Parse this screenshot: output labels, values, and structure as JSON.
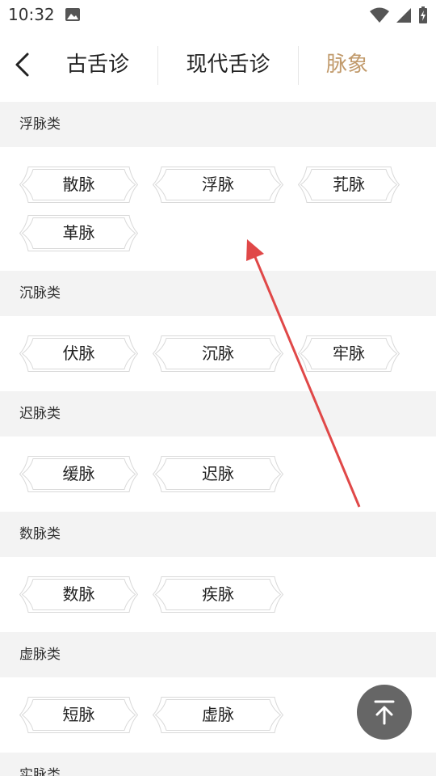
{
  "status_bar": {
    "time": "10:32"
  },
  "nav": {
    "tabs": [
      {
        "label": "古舌诊",
        "active": false
      },
      {
        "label": "现代舌诊",
        "active": false
      },
      {
        "label": "脉象",
        "active": true
      }
    ]
  },
  "categories": [
    {
      "title": "浮脉类",
      "items": [
        "散脉",
        "浮脉",
        "芤脉",
        "革脉"
      ]
    },
    {
      "title": "沉脉类",
      "items": [
        "伏脉",
        "沉脉",
        "牢脉"
      ]
    },
    {
      "title": "迟脉类",
      "items": [
        "缓脉",
        "迟脉"
      ]
    },
    {
      "title": "数脉类",
      "items": [
        "数脉",
        "疾脉"
      ]
    },
    {
      "title": "虚脉类",
      "items": [
        "短脉",
        "虚脉"
      ]
    },
    {
      "title": "实脉类",
      "items": []
    }
  ],
  "colors": {
    "accent": "#c19a6b",
    "section_bg": "#f3f3f3",
    "annotation_arrow": "#e04848",
    "back_top_bg": "#666666"
  },
  "icons": {
    "back": "chevron-left-icon",
    "back_to_top": "arrow-up-to-top-icon"
  }
}
